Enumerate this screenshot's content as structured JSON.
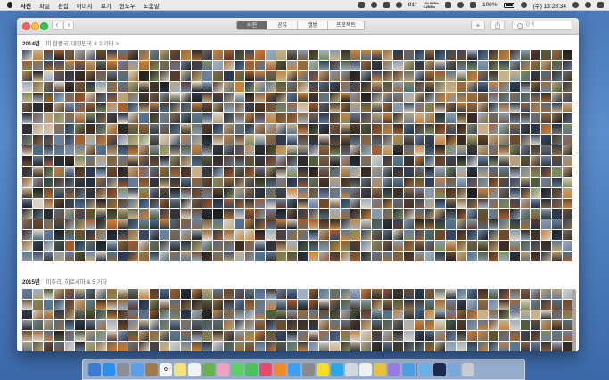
{
  "menubar": {
    "items": [
      "사진",
      "파일",
      "편집",
      "이미지",
      "보기",
      "윈도우",
      "도움말"
    ],
    "network_up": "104.8KB/s",
    "network_down": "6.2KB/s",
    "temperature": "81°",
    "battery": "100%",
    "clock": "(수) 13:28:34"
  },
  "toolbar": {
    "back_label": "‹",
    "forward_label": "›",
    "tabs": [
      {
        "label": "사진",
        "active": true
      },
      {
        "label": "공유",
        "active": false
      },
      {
        "label": "앨범",
        "active": false
      },
      {
        "label": "프로젝트",
        "active": false
      }
    ],
    "add_label": "+",
    "search_placeholder": "검색"
  },
  "sections": [
    {
      "year": "2014년",
      "places": "미 합중국, 대한민국 & 2 기타 >"
    },
    {
      "year": "2015년",
      "places": "미주리, 히로시마 & 5 기타"
    }
  ],
  "colors": {
    "selected_tab": "#6b6b6b",
    "desktop": "#4a78b8",
    "close": "#fc605c",
    "minimize": "#fdbc40",
    "zoom": "#34c84a"
  },
  "icons": [
    "apple-icon",
    "back-icon",
    "forward-icon",
    "add-icon",
    "share-icon",
    "search-icon"
  ],
  "dock": {
    "apps": [
      "finder",
      "safari",
      "launchpad",
      "mail",
      "contacts",
      "calendar",
      "notes",
      "reminders",
      "maps",
      "photos",
      "messages",
      "facetime",
      "itunes",
      "ibooks",
      "app-store",
      "system-preferences",
      "kakaotalk",
      "skype",
      "preview",
      "textedit",
      "chrome",
      "photos-2",
      "downloads",
      "folder",
      "photoshop",
      "documents",
      "trash"
    ],
    "calendar_day": "6"
  }
}
